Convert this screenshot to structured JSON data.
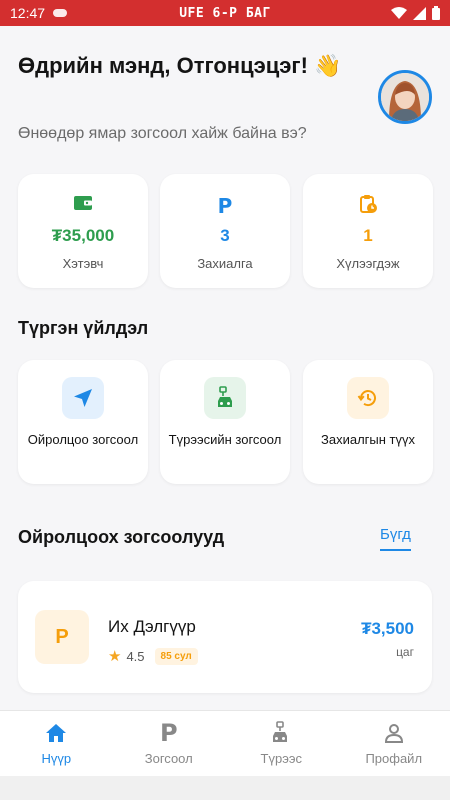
{
  "status_bar": {
    "time": "12:47",
    "carrier": "UFE 6-Р БАГ"
  },
  "header": {
    "greeting": "Өдрийн мэнд, Отгонцэцэг! 👋",
    "subtitle": "Өнөөдөр ямар зогсоол хайж байна вэ?"
  },
  "stats": [
    {
      "icon": "wallet-icon",
      "value": "₮35,000",
      "label": "Хэтэвч",
      "color": "#2e9d4e"
    },
    {
      "icon": "parking-icon",
      "value": "3",
      "label": "Захиалга",
      "color": "#1e88e5"
    },
    {
      "icon": "clipboard-clock-icon",
      "value": "1",
      "label": "Хүлээгдэж",
      "color": "#f59e0b"
    }
  ],
  "quick_actions": {
    "title": "Түргэн үйлдэл",
    "items": [
      {
        "icon": "navigation-icon",
        "label": "Ойролцоо зогсоол",
        "bg": "#e3f0fd",
        "color": "#1e88e5"
      },
      {
        "icon": "car-parking-icon",
        "label": "Түрээсийн зогсоол",
        "bg": "#e6f4ea",
        "color": "#2e9d4e"
      },
      {
        "icon": "history-icon",
        "label": "Захиалгын түүх",
        "bg": "#fff3e0",
        "color": "#f59e0b"
      }
    ]
  },
  "nearby": {
    "title": "Ойролцоох зогсоолууд",
    "see_all": "Бүгд",
    "items": [
      {
        "icon_letter": "P",
        "name": "Их Дэлгүүр",
        "rating": "4.5",
        "spots": "85 сул",
        "price": "₮3,500",
        "unit": "цаг"
      }
    ]
  },
  "nav": [
    {
      "icon": "home-icon",
      "label": "Нүүр",
      "active": true
    },
    {
      "icon": "parking-icon",
      "label": "Зогсоол",
      "active": false
    },
    {
      "icon": "car-rent-icon",
      "label": "Түрээс",
      "active": false
    },
    {
      "icon": "profile-icon",
      "label": "Профайл",
      "active": false
    }
  ],
  "colors": {
    "accent": "#1e88e5",
    "status_bar": "#d32f2f",
    "green": "#2e9d4e",
    "orange": "#f59e0b"
  }
}
